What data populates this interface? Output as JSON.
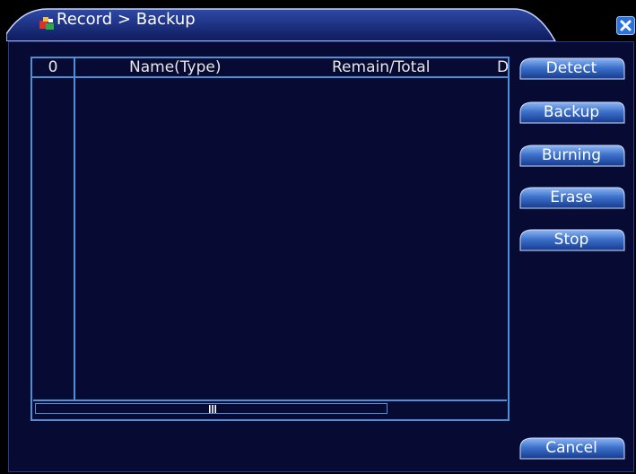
{
  "window": {
    "title": "Record > Backup"
  },
  "device_list": {
    "columns": {
      "index": "0",
      "name": "Name(Type)",
      "remain_total": "Remain/Total",
      "d": "D"
    },
    "rows": []
  },
  "actions": {
    "detect": "Detect",
    "backup": "Backup",
    "burning": "Burning",
    "erase": "Erase",
    "stop": "Stop",
    "cancel": "Cancel"
  },
  "colors": {
    "panel": "#070b33",
    "border": "#4f8fd6",
    "title_bar": "#1a2f86",
    "close": "#2b73d8"
  },
  "icons": {
    "title": "record-backup-icon",
    "close": "close-icon",
    "scroll_grip": "scroll-grip-icon"
  }
}
